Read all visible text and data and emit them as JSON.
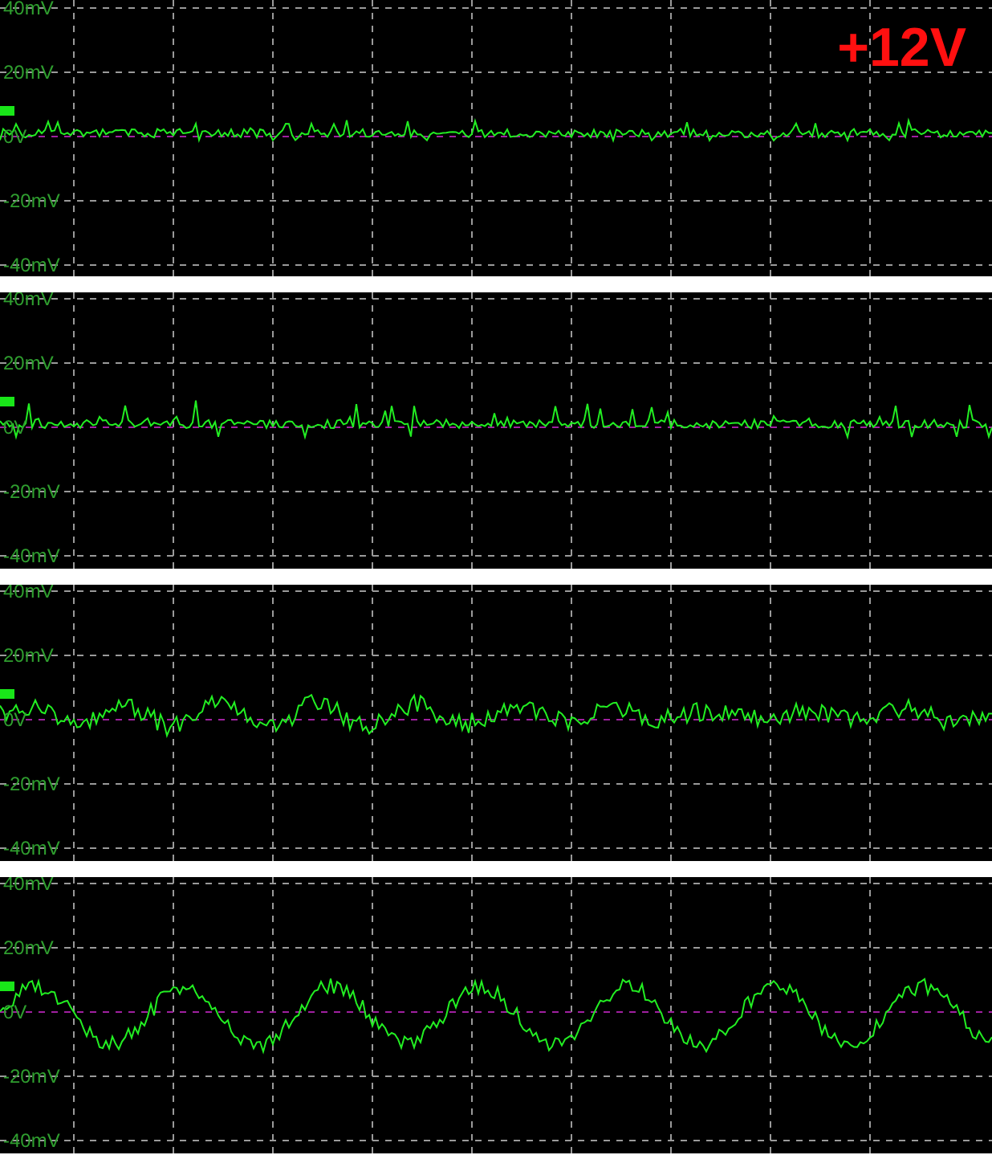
{
  "title_badge": "+12V",
  "panels": [
    {
      "axis_labels": [
        "40mV",
        "20mV",
        "0V",
        "-20mV",
        "-40mV"
      ]
    },
    {
      "axis_labels": [
        "40mV",
        "20mV",
        "0V",
        "-20mV",
        "-40mV"
      ]
    },
    {
      "axis_labels": [
        "40mV",
        "20mV",
        "0V",
        "-20mV",
        "-40mV"
      ]
    },
    {
      "axis_labels": [
        "40mV",
        "20mV",
        "0V",
        "-20mV",
        "-40mV"
      ]
    }
  ]
}
